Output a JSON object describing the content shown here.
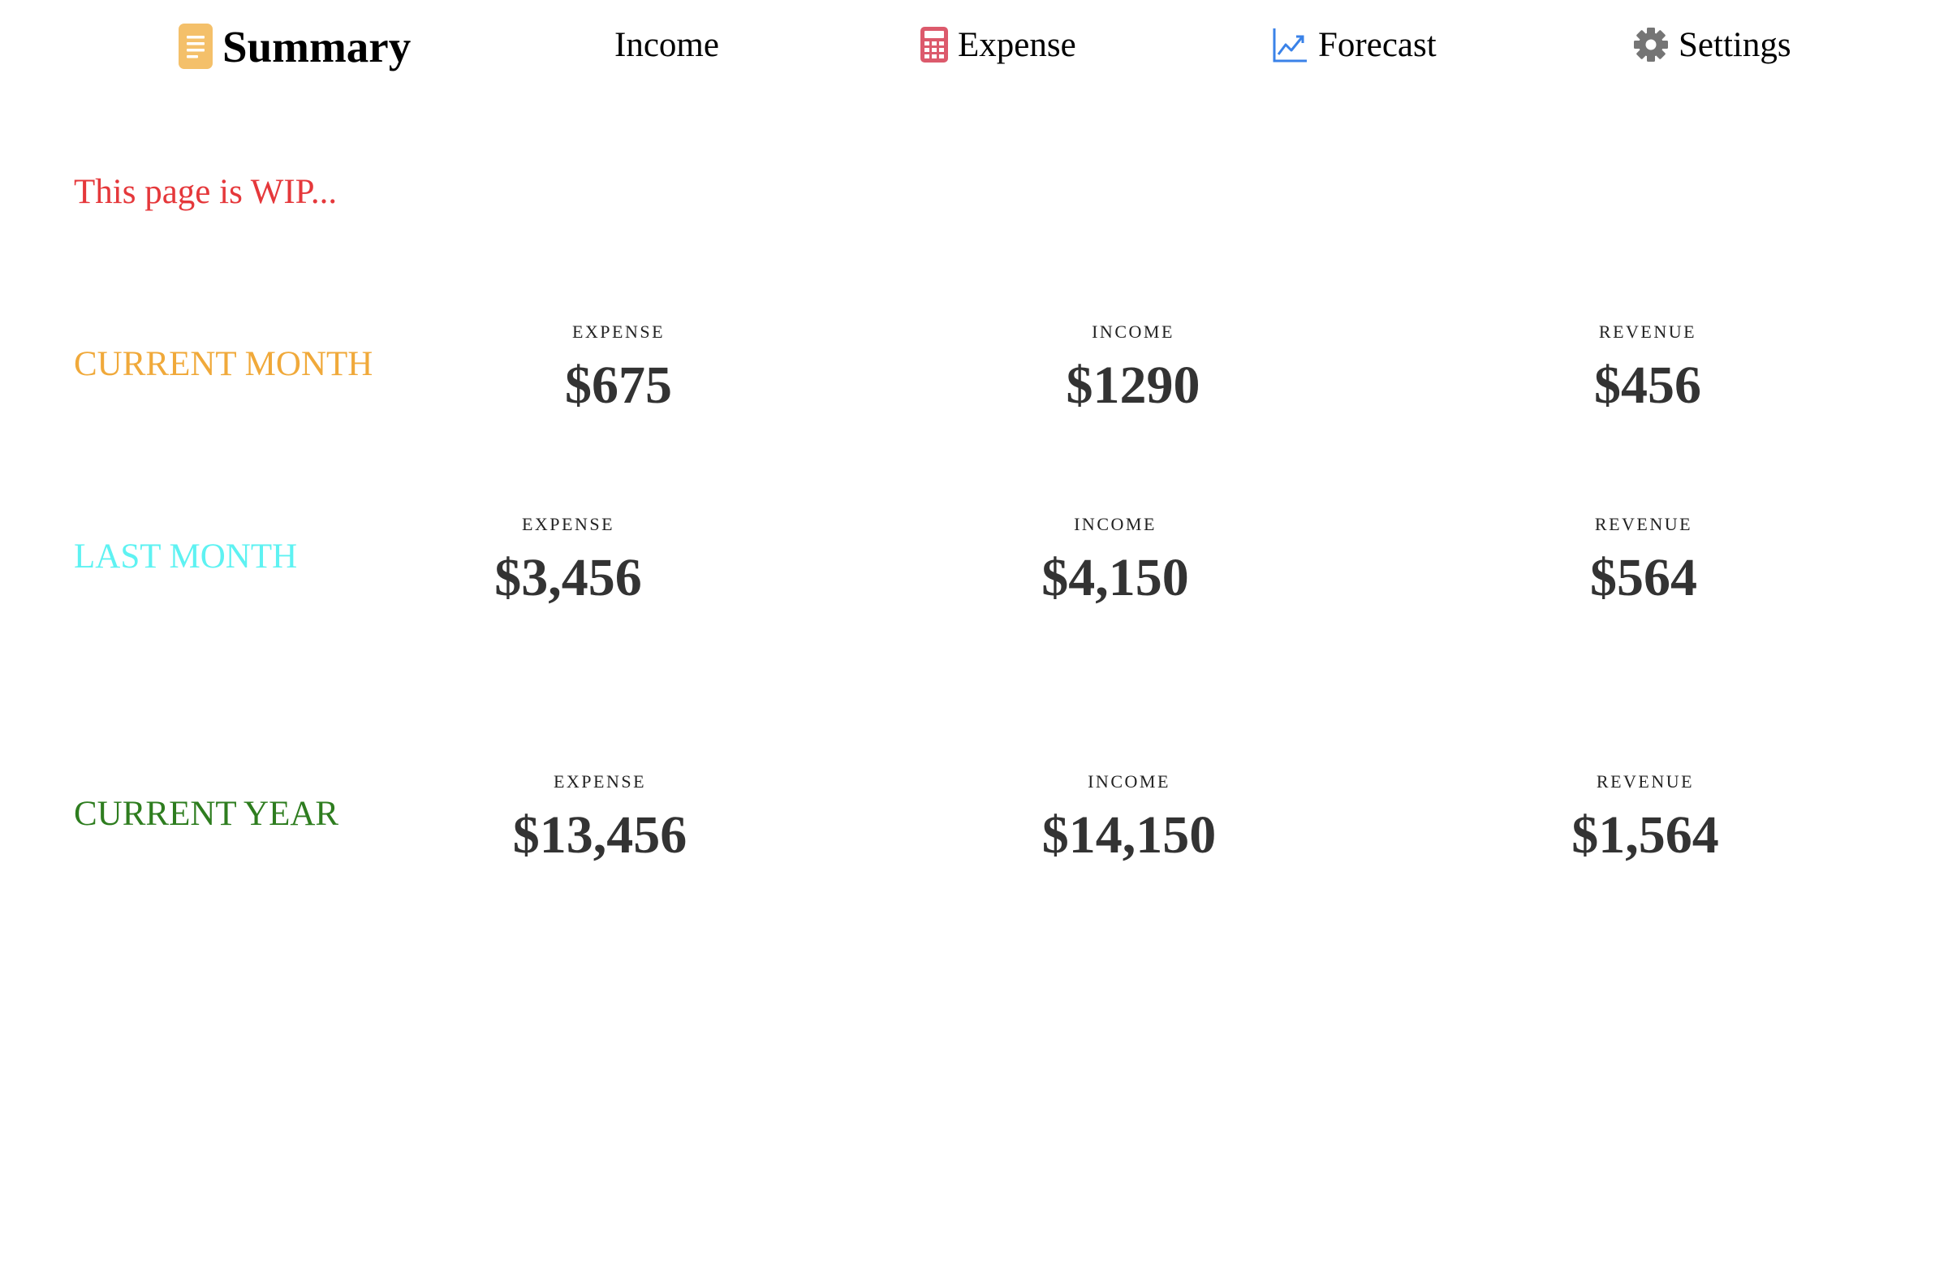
{
  "nav": {
    "items": [
      {
        "label": "Summary",
        "icon": "document-icon",
        "active": true
      },
      {
        "label": "Income",
        "icon": "",
        "active": false
      },
      {
        "label": "Expense",
        "icon": "calculator-icon",
        "active": false
      },
      {
        "label": "Forecast",
        "icon": "trending-up-icon",
        "active": false
      },
      {
        "label": "Settings",
        "icon": "gear-icon",
        "active": false
      }
    ]
  },
  "notice": "This page is WIP...",
  "colors": {
    "summary_icon": "#f4c06a",
    "expense_icon": "#dc5a6c",
    "forecast_icon": "#3a82e8",
    "settings_icon": "#757575",
    "notice": "#e5383b",
    "current_month": "#f0a93a",
    "last_month": "#5ef2f2",
    "current_year": "#2e7d1f"
  },
  "rows": [
    {
      "label": "CURRENT MONTH",
      "stats": [
        {
          "caption": "EXPENSE",
          "value": "$675"
        },
        {
          "caption": "INCOME",
          "value": "$1290"
        },
        {
          "caption": "REVENUE",
          "value": "$456"
        }
      ]
    },
    {
      "label": "LAST MONTH",
      "stats": [
        {
          "caption": "EXPENSE",
          "value": "$3,456"
        },
        {
          "caption": "INCOME",
          "value": "$4,150"
        },
        {
          "caption": "REVENUE",
          "value": "$564"
        }
      ]
    },
    {
      "label": "CURRENT YEAR",
      "stats": [
        {
          "caption": "EXPENSE",
          "value": "$13,456"
        },
        {
          "caption": "INCOME",
          "value": "$14,150"
        },
        {
          "caption": "REVENUE",
          "value": "$1,564"
        }
      ]
    }
  ]
}
